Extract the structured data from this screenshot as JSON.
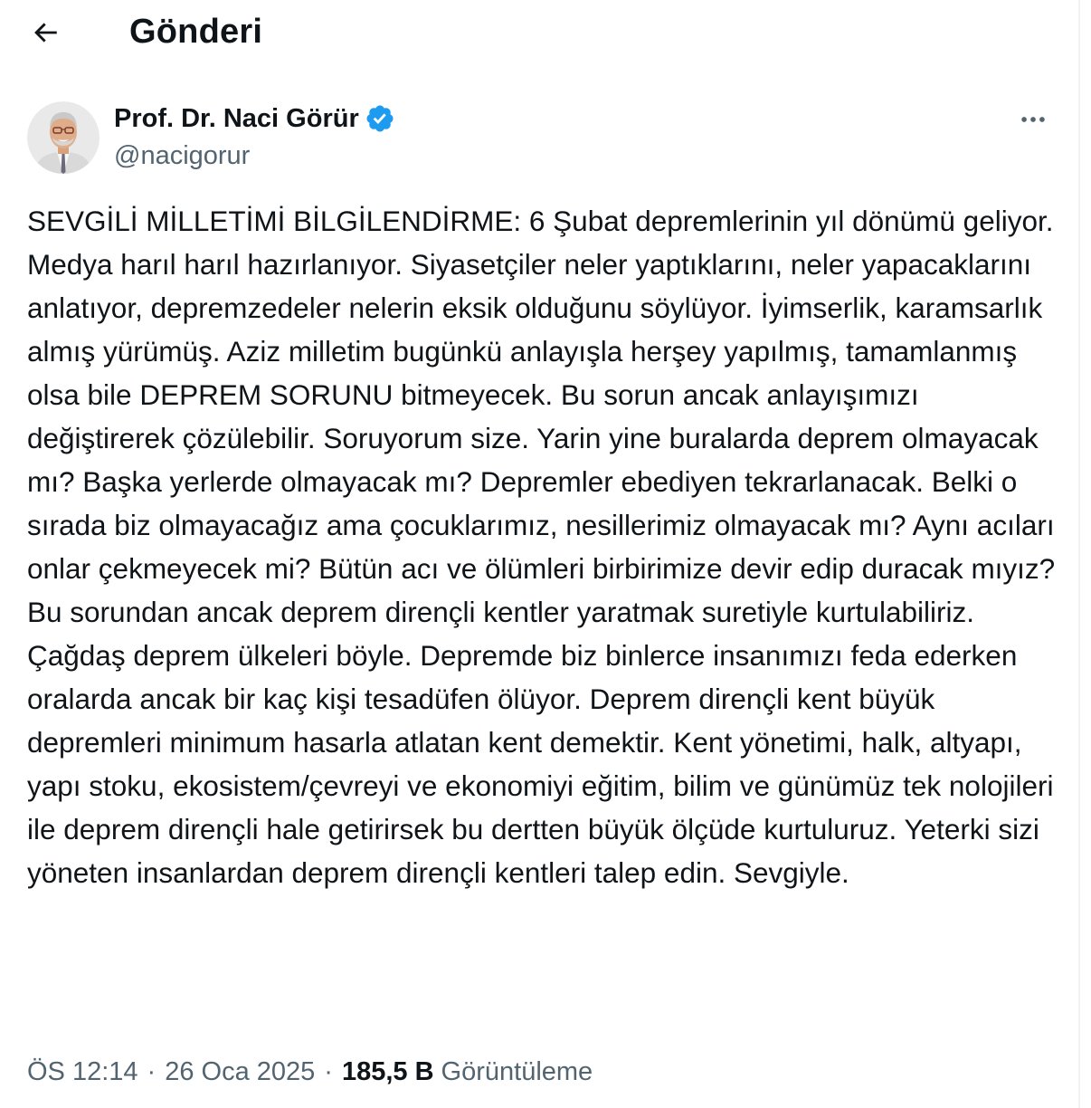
{
  "header": {
    "title": "Gönderi"
  },
  "author": {
    "name": "Prof. Dr. Naci Görür",
    "handle": "@nacigorur",
    "verified": true
  },
  "tweet": {
    "text": "SEVGİLİ MİLLETİMİ BİLGİLENDİRME: 6 Şubat depremlerinin yıl dönümü geliyor. Medya harıl harıl hazırlanıyor. Siyasetçiler neler yaptıklarını, neler yapacaklarını anlatıyor, depremzedeler nelerin eksik olduğunu söylüyor. İyimserlik, karamsarlık almış yürümüş. Aziz milletim bugünkü anlayışla herşey yapılmış, tamamlanmış olsa bile DEPREM SORUNU bitmeyecek. Bu sorun ancak anlayışımızı değiştirerek çözülebilir. Soruyorum size. Yarin yine buralarda deprem olmayacak mı? Başka yerlerde olmayacak mı? Depremler ebediyen tekrarlanacak. Belki o sırada biz olmayacağız ama çocuklarımız, nesillerimiz olmayacak mı? Aynı acıları onlar çekmeyecek mi? Bütün acı ve ölümleri birbirimize devir edip duracak mıyız?\nBu sorundan ancak deprem dirençli kentler yaratmak suretiyle kurtulabiliriz. Çağdaş deprem ülkeleri böyle. Depremde biz binlerce insanımızı feda ederken oralarda ancak bir kaç kişi tesadüfen ölüyor. Deprem dirençli kent büyük depremleri minimum hasarla atlatan kent demektir. Kent yönetimi, halk, altyapı, yapı stoku, ekosistem/çevreyi ve ekonomiyi eğitim, bilim ve günümüz tek nolojileri ile deprem dirençli hale getirirsek bu dertten büyük ölçüde kurtuluruz. Yeterki sizi yöneten insanlardan deprem dirençli kentleri talep edin. Sevgiyle."
  },
  "meta": {
    "time": "ÖS 12:14",
    "separator": "·",
    "date": "26 Oca 2025",
    "views_count": "185,5 B",
    "views_label": "Görüntüleme"
  },
  "icons": {
    "back": "arrow-left-icon",
    "verified": "verified-badge-icon",
    "more": "more-horizontal-icon"
  },
  "colors": {
    "text": "#0f1419",
    "secondary": "#536471",
    "verified": "#1d9bf0",
    "divider": "#eff3f4"
  }
}
